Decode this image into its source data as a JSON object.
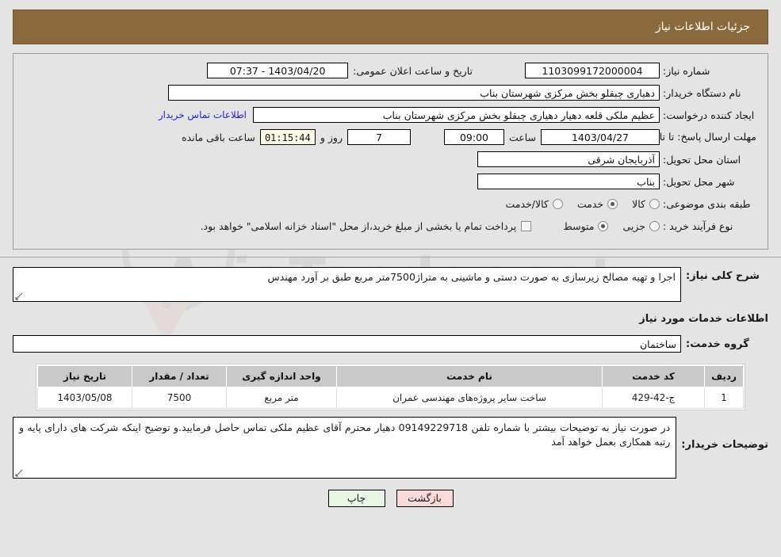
{
  "header": {
    "title": "جزئیات اطلاعات نیاز"
  },
  "fields": {
    "need_number_label": "شماره نیاز:",
    "need_number_value": "1103099172000004",
    "announce_datetime_label": "تاریخ و ساعت اعلان عمومی:",
    "announce_datetime_value": "1403/04/20 - 07:37",
    "buyer_org_label": "نام دستگاه خریدار:",
    "buyer_org_value": "دهیاری چبقلو بخش مرکزی شهرستان بناب",
    "requester_label": "ایجاد کننده درخواست:",
    "requester_value": "عظیم ملکی قلعه دهیار دهیاری چبقلو بخش مرکزی شهرستان بناب",
    "contact_link": "اطلاعات تماس خریدار",
    "deadline_label": "مهلت ارسال پاسخ: تا تاریخ:",
    "deadline_date": "1403/04/27",
    "hour_label": "ساعت",
    "deadline_time": "09:00",
    "days_value": "7",
    "days_label": "روز و",
    "countdown_value": "01:15:44",
    "countdown_label": "ساعت باقی مانده",
    "province_label": "استان محل تحویل:",
    "province_value": "آذربایجان شرقی",
    "city_label": "شهر محل تحویل:",
    "city_value": "بناب",
    "category_label": "طبقه بندی موضوعی:",
    "process_type_label": "نوع فرآیند خرید :",
    "treasury_note": "پرداخت تمام یا بخشی از مبلغ خرید،از محل \"اسناد خزانه اسلامی\" خواهد بود."
  },
  "category_options": [
    {
      "label": "کالا",
      "selected": false
    },
    {
      "label": "خدمت",
      "selected": true
    },
    {
      "label": "کالا/خدمت",
      "selected": false
    }
  ],
  "process_options": [
    {
      "label": "جزیی",
      "selected": false
    },
    {
      "label": "متوسط",
      "selected": true
    }
  ],
  "description": {
    "label": "شرح کلی نیاز:",
    "value": "اجرا و تهیه مصالح زیرسازی به صورت دستی و ماشینی به متراژ7500متر مربع طبق بر آورد مهندس"
  },
  "services_section": {
    "title": "اطلاعات خدمات مورد نیاز",
    "group_label": "گروه خدمت:",
    "group_value": "ساختمان"
  },
  "table": {
    "headers": [
      "ردیف",
      "کد خدمت",
      "نام خدمت",
      "واحد اندازه گیری",
      "تعداد / مقدار",
      "تاریخ نیاز"
    ],
    "rows": [
      {
        "row_no": "1",
        "service_code": "ج-42-429",
        "service_name": "ساخت سایر پروژه‌های مهندسی عمران",
        "unit": "متر مربع",
        "quantity": "7500",
        "need_date": "1403/05/08"
      }
    ]
  },
  "buyer_notes": {
    "label": "توضیحات خریدار:",
    "value": "در صورت نیاز به توضیحات بیشتر با شماره تلفن 09149229718 دهیار محترم آقای عظیم ملکی تماس حاصل فرمایید.و توضیح اینکه شرکت های دارای پایه و رتبه همکاری بعمل خواهد آمد"
  },
  "footer": {
    "print_label": "چاپ",
    "back_label": "بازگشت"
  },
  "watermark": {
    "text": "AriaTender.net"
  },
  "colors": {
    "header_bg": "#8a6a3d",
    "link": "#2020d8",
    "print_btn": "#e8f6e4",
    "back_btn": "#fad9d9",
    "timer_bg": "#fbfbe8"
  }
}
